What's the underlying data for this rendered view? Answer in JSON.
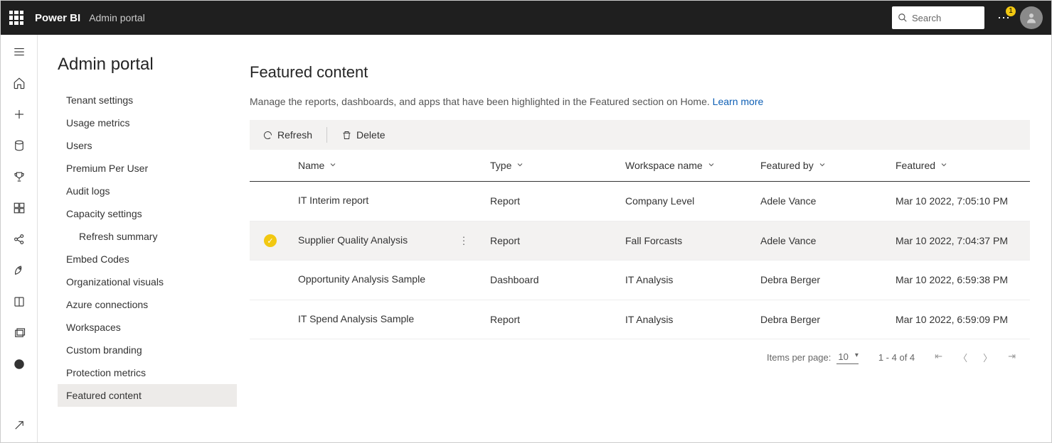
{
  "header": {
    "brand": "Power BI",
    "section": "Admin portal",
    "search_placeholder": "Search",
    "notification_count": "1"
  },
  "page": {
    "title": "Admin portal"
  },
  "admin_nav": {
    "items": [
      {
        "label": "Tenant settings",
        "sub": false,
        "active": false
      },
      {
        "label": "Usage metrics",
        "sub": false,
        "active": false
      },
      {
        "label": "Users",
        "sub": false,
        "active": false
      },
      {
        "label": "Premium Per User",
        "sub": false,
        "active": false
      },
      {
        "label": "Audit logs",
        "sub": false,
        "active": false
      },
      {
        "label": "Capacity settings",
        "sub": false,
        "active": false
      },
      {
        "label": "Refresh summary",
        "sub": true,
        "active": false
      },
      {
        "label": "Embed Codes",
        "sub": false,
        "active": false
      },
      {
        "label": "Organizational visuals",
        "sub": false,
        "active": false
      },
      {
        "label": "Azure connections",
        "sub": false,
        "active": false
      },
      {
        "label": "Workspaces",
        "sub": false,
        "active": false
      },
      {
        "label": "Custom branding",
        "sub": false,
        "active": false
      },
      {
        "label": "Protection metrics",
        "sub": false,
        "active": false
      },
      {
        "label": "Featured content",
        "sub": false,
        "active": true
      }
    ]
  },
  "main": {
    "heading": "Featured content",
    "description": "Manage the reports, dashboards, and apps that have been highlighted in the Featured section on Home.",
    "learn_more": "Learn more",
    "toolbar": {
      "refresh": "Refresh",
      "delete": "Delete"
    },
    "columns": {
      "name": "Name",
      "type": "Type",
      "workspace": "Workspace name",
      "featured_by": "Featured by",
      "featured": "Featured"
    },
    "rows": [
      {
        "selected": false,
        "name": "IT Interim report",
        "type": "Report",
        "workspace": "Company Level",
        "featured_by": "Adele Vance",
        "featured": "Mar 10 2022, 7:05:10 PM"
      },
      {
        "selected": true,
        "name": "Supplier Quality Analysis",
        "type": "Report",
        "workspace": "Fall Forcasts",
        "featured_by": "Adele Vance",
        "featured": "Mar 10 2022, 7:04:37 PM"
      },
      {
        "selected": false,
        "name": "Opportunity Analysis Sample",
        "type": "Dashboard",
        "workspace": "IT Analysis",
        "featured_by": "Debra Berger",
        "featured": "Mar 10 2022, 6:59:38 PM"
      },
      {
        "selected": false,
        "name": "IT Spend Analysis Sample",
        "type": "Report",
        "workspace": "IT Analysis",
        "featured_by": "Debra Berger",
        "featured": "Mar 10 2022, 6:59:09 PM"
      }
    ]
  },
  "pager": {
    "items_per_page_label": "Items per page:",
    "items_per_page_value": "10",
    "range": "1 - 4 of 4"
  }
}
